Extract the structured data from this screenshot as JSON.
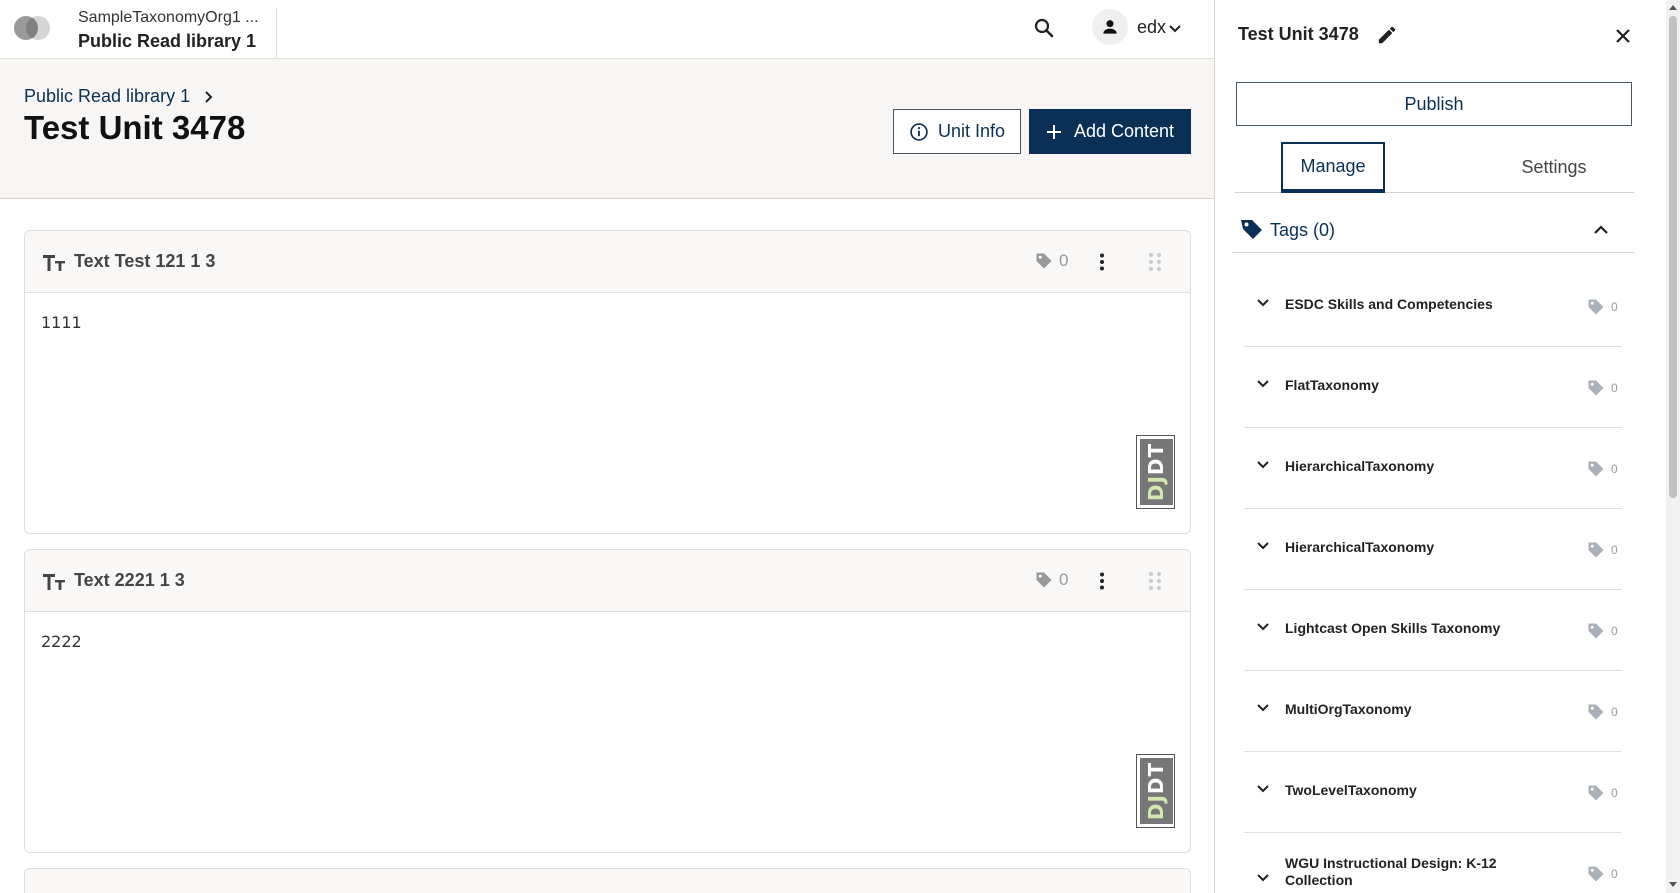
{
  "topbar": {
    "org_name": "SampleTaxonomyOrg1 ...",
    "library_name": "Public Read library 1",
    "user_name": "edx",
    "icons": {
      "search": "search-icon",
      "avatar": "person-icon",
      "menu": "chevron-down-icon"
    }
  },
  "header": {
    "breadcrumb": "Public Read library 1",
    "title": "Test Unit 3478",
    "unit_info_label": "Unit Info",
    "add_content_label": "Add Content"
  },
  "blocks": [
    {
      "title": "Text Test 121 1 3",
      "tag_count": "0",
      "content": "1111"
    },
    {
      "title": "Text 2221 1 3",
      "tag_count": "0",
      "content": "2222"
    }
  ],
  "djdt": {
    "dj": "DJ",
    "dt": "DT"
  },
  "sidebar": {
    "title": "Test Unit 3478",
    "publish_label": "Publish",
    "tabs": [
      {
        "label": "Manage",
        "active": true
      },
      {
        "label": "Settings",
        "active": false
      }
    ],
    "tags_header": "Tags (0)",
    "taxonomies": [
      {
        "name": "ESDC Skills and Competencies",
        "count": "0"
      },
      {
        "name": "FlatTaxonomy",
        "count": "0"
      },
      {
        "name": "HierarchicalTaxonomy",
        "count": "0"
      },
      {
        "name": "HierarchicalTaxonomy",
        "count": "0"
      },
      {
        "name": "Lightcast Open Skills Taxonomy",
        "count": "0"
      },
      {
        "name": "MultiOrgTaxonomy",
        "count": "0"
      },
      {
        "name": "TwoLevelTaxonomy",
        "count": "0"
      },
      {
        "name": "WGU Instructional Design: K-12 Collection",
        "count": "0"
      }
    ]
  },
  "colors": {
    "brand": "#0a3055",
    "muted": "#9a9a9a",
    "border": "#e1ddd9"
  }
}
